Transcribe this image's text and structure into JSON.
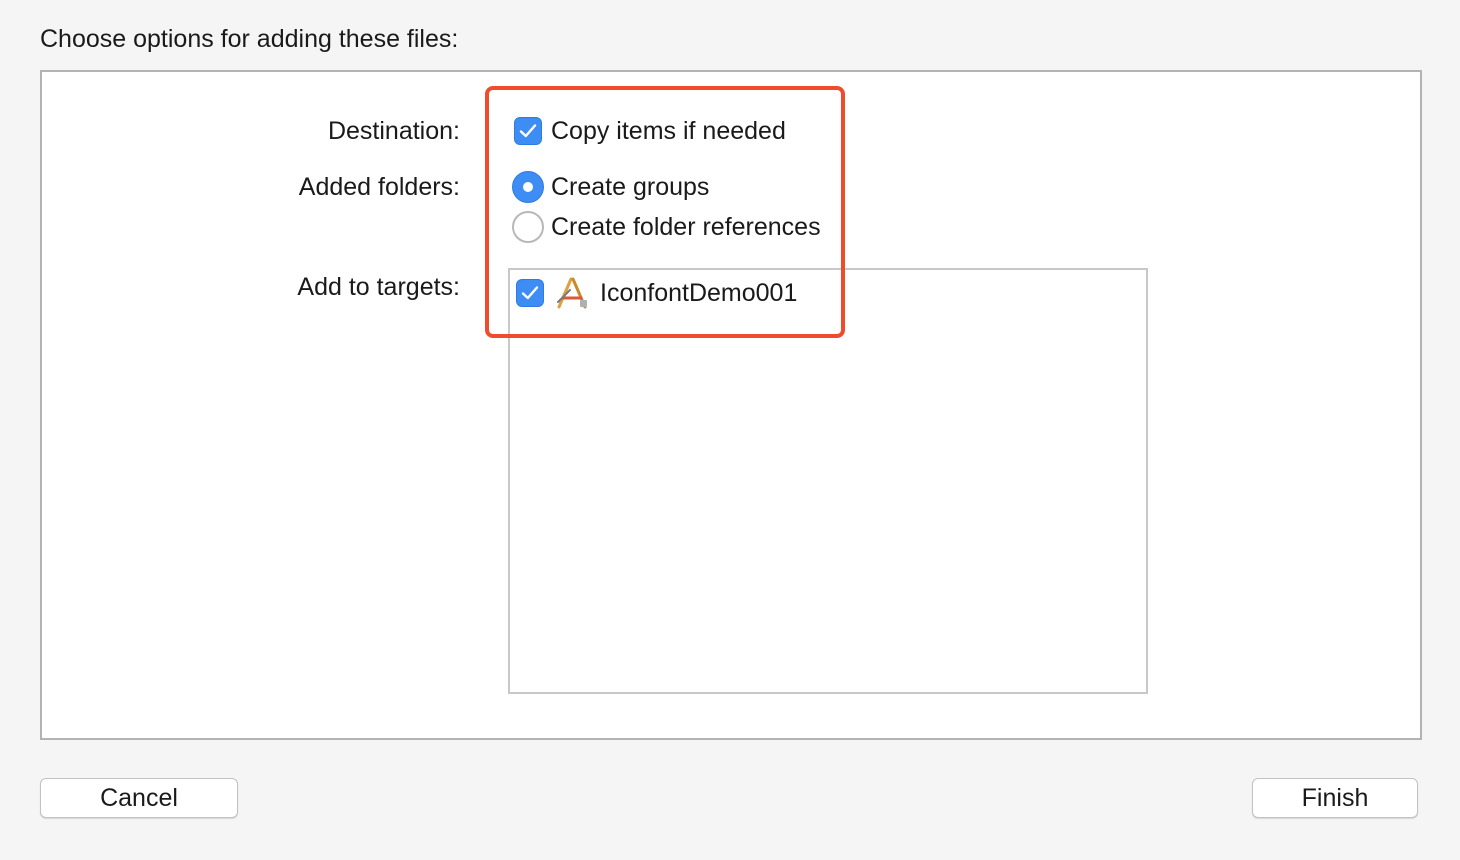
{
  "dialog": {
    "title": "Choose options for adding these files:"
  },
  "options": {
    "destination": {
      "label": "Destination:",
      "checkbox_label": "Copy items if needed",
      "checked": true
    },
    "added_folders": {
      "label": "Added folders:",
      "choices": [
        {
          "label": "Create groups",
          "selected": true
        },
        {
          "label": "Create folder references",
          "selected": false
        }
      ]
    },
    "targets": {
      "label": "Add to targets:",
      "items": [
        {
          "name": "IconfontDemo001",
          "checked": true,
          "icon": "xcode-app-icon"
        }
      ]
    }
  },
  "buttons": {
    "cancel": "Cancel",
    "finish": "Finish"
  },
  "colors": {
    "accent": "#3d8df5",
    "highlight": "#f04b2d",
    "background": "#f5f5f5"
  }
}
